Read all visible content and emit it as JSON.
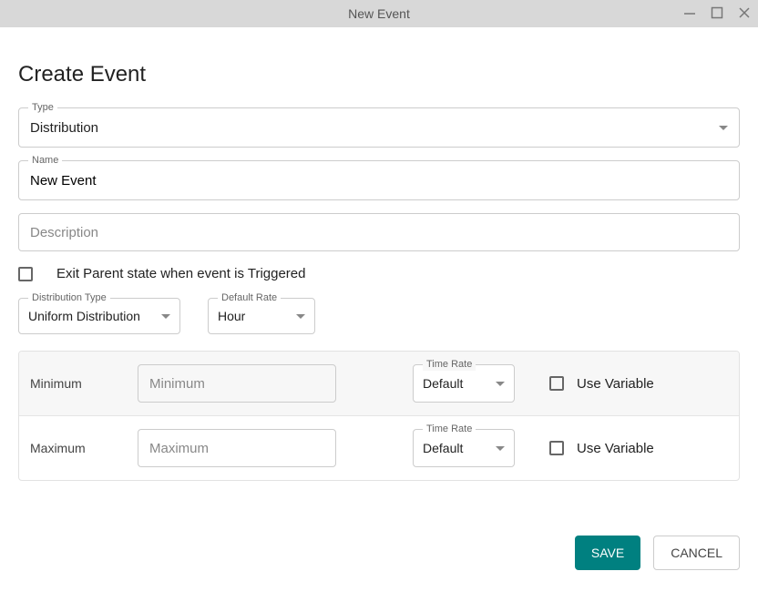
{
  "window": {
    "title": "New Event"
  },
  "header": {
    "title": "Create Event"
  },
  "form": {
    "type": {
      "label": "Type",
      "value": "Distribution"
    },
    "name": {
      "label": "Name",
      "value": "New Event"
    },
    "description": {
      "placeholder": "Description",
      "value": ""
    },
    "exit_parent": {
      "label": "Exit Parent state when event is Triggered",
      "checked": false
    },
    "distribution_type": {
      "label": "Distribution Type",
      "value": "Uniform Distribution"
    },
    "default_rate": {
      "label": "Default Rate",
      "value": "Hour"
    }
  },
  "params": {
    "minimum": {
      "label": "Minimum",
      "placeholder": "Minimum",
      "value": "",
      "time_rate": {
        "label": "Time Rate",
        "value": "Default"
      },
      "use_variable": {
        "label": "Use Variable",
        "checked": false
      }
    },
    "maximum": {
      "label": "Maximum",
      "placeholder": "Maximum",
      "value": "",
      "time_rate": {
        "label": "Time Rate",
        "value": "Default"
      },
      "use_variable": {
        "label": "Use Variable",
        "checked": false
      }
    }
  },
  "footer": {
    "save": "SAVE",
    "cancel": "CANCEL"
  }
}
